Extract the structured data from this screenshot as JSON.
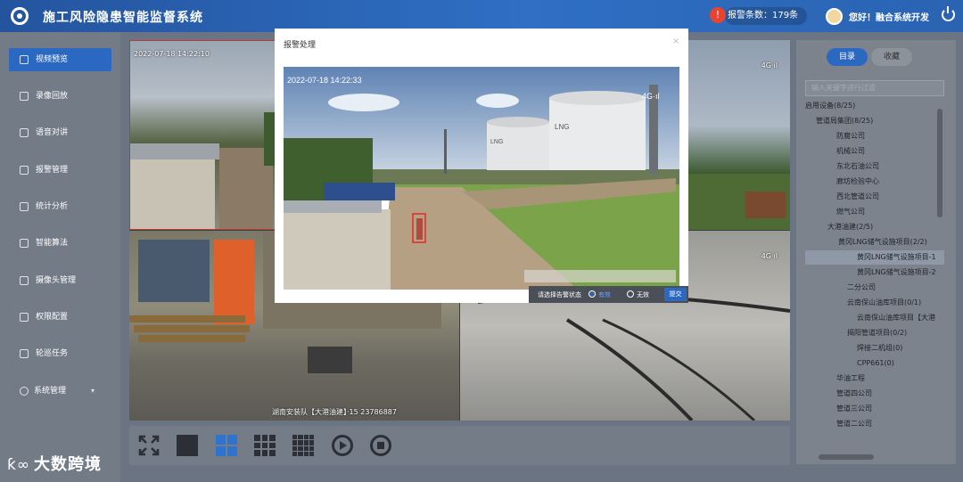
{
  "header": {
    "title": "施工风险隐患智能监督系统",
    "alarm_label": "报警条数：179条",
    "user_greeting": "您好！融合系统开发"
  },
  "sidebar": {
    "items": [
      {
        "label": "视频预览",
        "active": true
      },
      {
        "label": "录像回放"
      },
      {
        "label": "语音对讲"
      },
      {
        "label": "报警管理"
      },
      {
        "label": "统计分析"
      },
      {
        "label": "智能算法"
      },
      {
        "label": "摄像头管理"
      },
      {
        "label": "权限配置"
      },
      {
        "label": "轮巡任务"
      },
      {
        "label": "系统管理"
      }
    ]
  },
  "videos": {
    "cell3_osd": "湖南安装队【大港油建】·15 23786887",
    "cell1_osd": "2022-07-18 14:22:10",
    "cell2_osd": "4G·ıl",
    "cell4_osd": "4G·ıl"
  },
  "right_panel": {
    "tabs": [
      "目录",
      "收藏"
    ],
    "search_placeholder": "输入关键字进行过滤",
    "tree": [
      "启用设备(8/25)",
      "管道局集团(8/25)",
      "防腐公司",
      "机械公司",
      "东北石油公司",
      "廊坊检验中心",
      "西北管道公司",
      "燃气公司",
      "大港油建(2/5)",
      "黄冈LNG储气设施项目(2/2)",
      "黄冈LNG储气设施项目-1",
      "黄冈LNG储气设施项目-2",
      "二分公司",
      "云南保山油库项目(0/1)",
      "云南保山油库项目【大港",
      "揭阳管道项目(0/2)",
      "焊接二机组(0)",
      "CPP661(0)",
      "华油工程",
      "管道四公司",
      "管道三公司",
      "管道二公司"
    ]
  },
  "modal": {
    "title": "报警处理",
    "close": "×",
    "timestamp": "2022-07-18 14:22:33",
    "signal": "4G·ıl",
    "tank_label": "LNG"
  },
  "action_bar": {
    "prompt": "请选择告警状态",
    "option_valid": "有效",
    "option_invalid": "无效",
    "submit": "提交"
  },
  "watermark": "大数跨境",
  "colors": {
    "accent": "#2a68c2",
    "header": "#2f6fc4",
    "alert": "#e8432e"
  }
}
